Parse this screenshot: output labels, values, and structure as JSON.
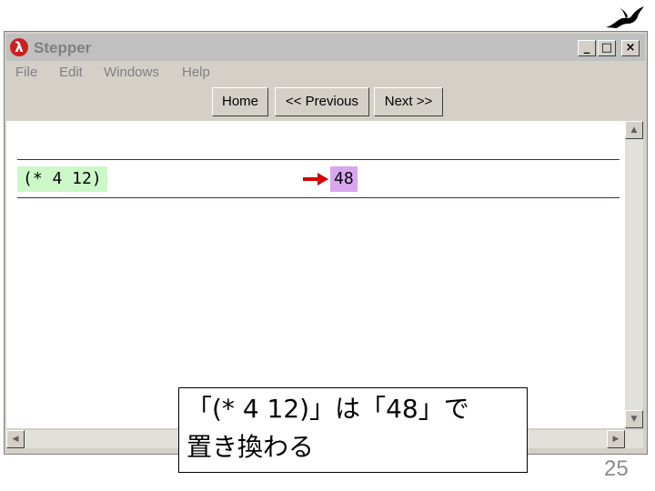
{
  "window": {
    "title": "Stepper",
    "app_icon": "λ",
    "controls": [
      "_",
      "□",
      "×"
    ]
  },
  "menu": [
    "File",
    "Edit",
    "Windows",
    "Help"
  ],
  "nav": {
    "home": "Home",
    "previous": "<< Previous",
    "next": "Next >>"
  },
  "step": {
    "expression": "(* 4 12)",
    "result": "48"
  },
  "callout": {
    "line1": "「(* 4 12)」は「48」で",
    "line2": "置き換わる"
  },
  "slide": {
    "page_number": "25"
  },
  "colors": {
    "expression_bg": "#ccf7c7",
    "result_bg": "#d9a6ee",
    "arrow": "#d40000",
    "rule": "#2f2f7f"
  }
}
